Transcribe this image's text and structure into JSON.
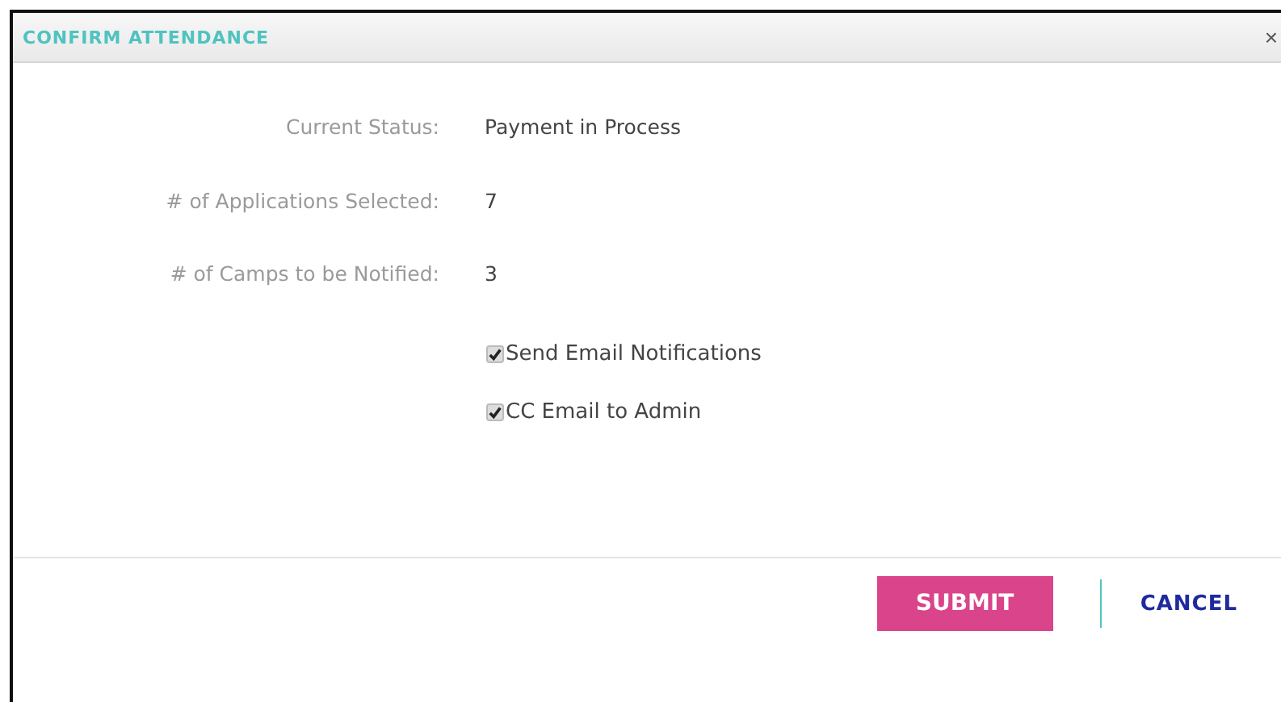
{
  "dialog": {
    "title": "CONFIRM ATTENDANCE",
    "close": "×"
  },
  "fields": [
    {
      "label": "Current Status:",
      "value": "Payment in Process"
    },
    {
      "label": "# of Applications Selected:",
      "value": "7"
    },
    {
      "label": "# of Camps to be Notified:",
      "value": "3"
    }
  ],
  "options": [
    {
      "label": "Send Email Notifications",
      "checked": true
    },
    {
      "label": "CC Email to Admin",
      "checked": true
    }
  ],
  "buttons": {
    "submit": "SUBMIT",
    "cancel": "CANCEL"
  }
}
